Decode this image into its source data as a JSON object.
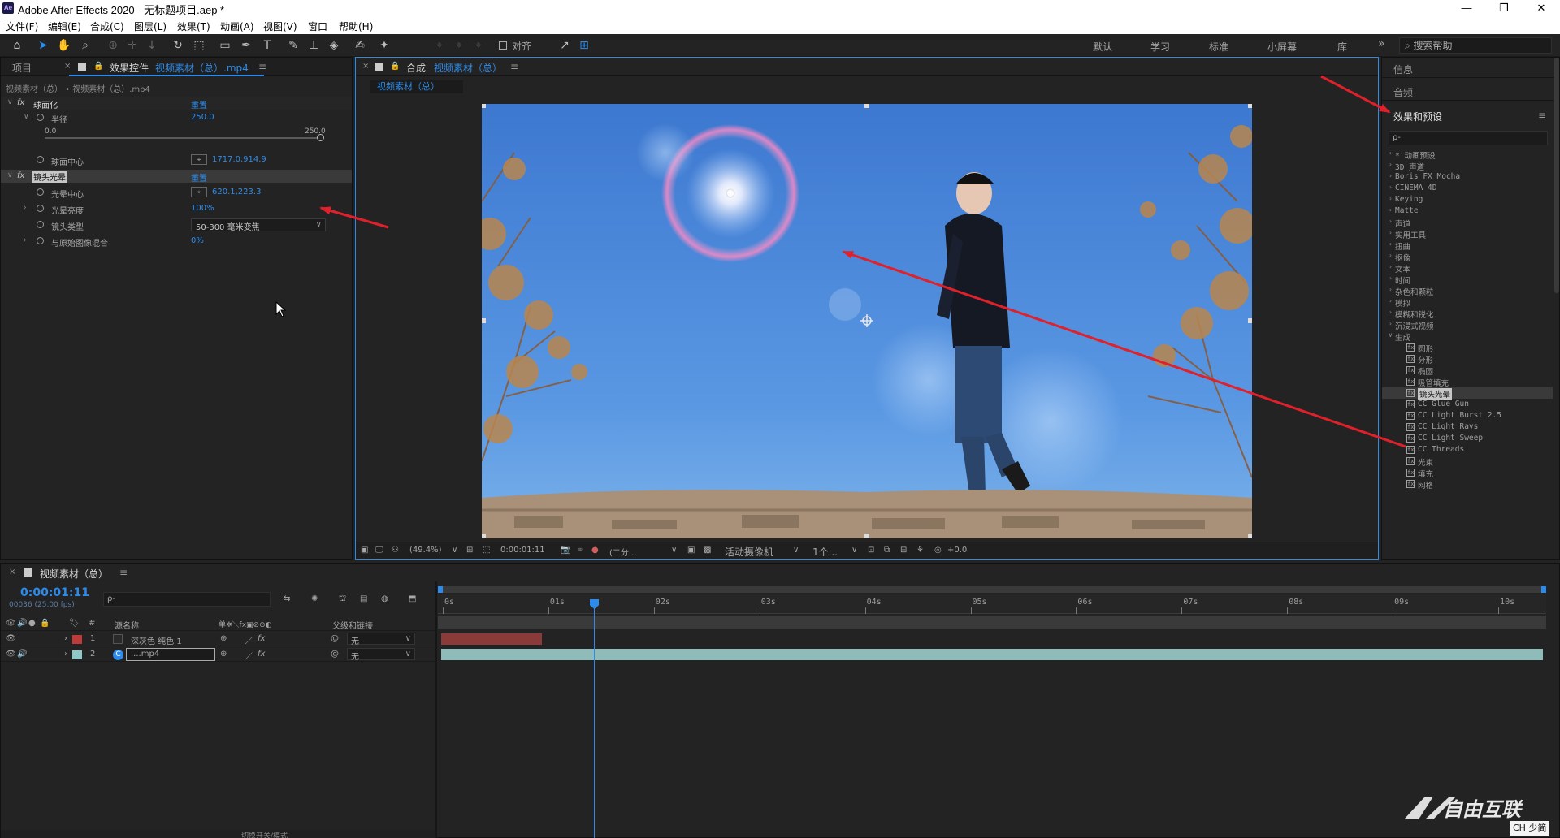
{
  "app": {
    "title": "Adobe After Effects 2020 - 无标题项目.aep *",
    "icon_text": "Ae",
    "window_controls": [
      "—",
      "❐",
      "✕"
    ]
  },
  "menu": [
    "文件(F)",
    "编辑(E)",
    "合成(C)",
    "图层(L)",
    "效果(T)",
    "动画(A)",
    "视图(V)",
    "窗口",
    "帮助(H)"
  ],
  "toolbar": {
    "snap_label": "对齐",
    "workspaces": [
      "默认",
      "学习",
      "标准",
      "小屏幕",
      "库"
    ],
    "more": "»",
    "search_placeholder": "搜索帮助"
  },
  "effect_controls": {
    "tab_project": "项目",
    "tab_prefix": "效果控件",
    "tab_layer": "视频素材（总）.mp4",
    "breadcrumb": "视频素材（总） • 视频素材（总）.mp4",
    "effects": [
      {
        "name": "球面化",
        "reset": "重置",
        "params": [
          {
            "label": "半径",
            "value": "250.0",
            "slider_min": "0.0",
            "slider_max": "250.0"
          },
          {
            "label": "球面中心",
            "value": "1717.0,914.9"
          }
        ]
      },
      {
        "name": "镜头光晕",
        "reset": "重置",
        "params": [
          {
            "label": "光晕中心",
            "value": "620.1,223.3"
          },
          {
            "label": "光晕亮度",
            "value": "100%"
          },
          {
            "label": "镜头类型",
            "value": "50-300 毫米变焦"
          },
          {
            "label": "与原始图像混合",
            "value": "0%"
          }
        ]
      }
    ]
  },
  "composition": {
    "tab_prefix": "合成",
    "tab_name": "视频素材（总）",
    "sub_tab": "视频素材（总）",
    "zoom": "(49.4%)",
    "timecode": "0:00:01:11",
    "resolution": "(二分...",
    "camera": "活动摄像机",
    "views": "1个...",
    "exposure": "+0.0"
  },
  "right_panel": {
    "info": "信息",
    "audio": "音频",
    "effects_title": "效果和预设",
    "search_placeholder": "ρ-",
    "categories": [
      "* 动画预设",
      "3D 声道",
      "Boris FX Mocha",
      "CINEMA 4D",
      "Keying",
      "Matte",
      "声道",
      "实用工具",
      "扭曲",
      "抠像",
      "文本",
      "时间",
      "杂色和颗粒",
      "模拟",
      "模糊和锐化",
      "沉浸式视频",
      "生成"
    ],
    "generate_children": [
      "圆形",
      "分形",
      "椭圆",
      "吸管填充",
      "镜头光晕",
      "CC Glue Gun",
      "CC Light Burst 2.5",
      "CC Light Rays",
      "CC Light Sweep",
      "CC Threads",
      "光束",
      "填充",
      "网格"
    ],
    "selected_child": "镜头光晕"
  },
  "timeline": {
    "tab_name": "视频素材（总）",
    "timecode": "0:00:01:11",
    "frame_info": "00036 (25.00 fps)",
    "search_placeholder": "ρ-",
    "col_hash": "#",
    "col_source": "源名称",
    "col_switches": "单✲＼fx▣⊘⊙◐",
    "col_parent": "父级和链接",
    "ruler": [
      "0s",
      "01s",
      "02s",
      "03s",
      "04s",
      "05s",
      "06s",
      "07s",
      "08s",
      "09s",
      "10s"
    ],
    "layers": [
      {
        "num": "1",
        "name": "深灰色 纯色 1",
        "parent": "无",
        "color": "#c03a3a"
      },
      {
        "num": "2",
        "name": "....mp4",
        "parent": "无",
        "color": "#8fc7c7"
      }
    ],
    "bottom_label": "切换开关/模式"
  },
  "watermark": {
    "brand": "自由互联",
    "ime": "CH 少简"
  },
  "colors": {
    "accent": "#2d8ceb",
    "arrow": "#e0202a",
    "sky": "#4b86d6"
  }
}
